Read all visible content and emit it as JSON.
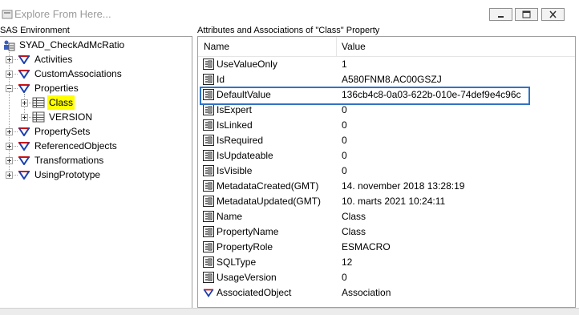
{
  "window": {
    "title": "Explore From Here...",
    "controls": [
      "minimize-icon",
      "maximize-icon",
      "close-icon"
    ]
  },
  "left_pane": {
    "header": "SAS Environment",
    "tree": [
      {
        "label": "SYAD_CheckAdMcRatio",
        "icon": "sas-object-icon",
        "expander": "none",
        "level": 0
      },
      {
        "label": "Activities",
        "icon": "association-icon",
        "expander": "plus",
        "level": 1
      },
      {
        "label": "CustomAssociations",
        "icon": "association-icon",
        "expander": "plus",
        "level": 1
      },
      {
        "label": "Properties",
        "icon": "association-icon",
        "expander": "minus",
        "level": 1
      },
      {
        "label": "Class",
        "icon": "table-icon",
        "expander": "plus",
        "level": 2,
        "highlighted": true
      },
      {
        "label": "VERSION",
        "icon": "table-icon",
        "expander": "plus",
        "level": 2
      },
      {
        "label": "PropertySets",
        "icon": "association-icon",
        "expander": "plus",
        "level": 1
      },
      {
        "label": "ReferencedObjects",
        "icon": "association-icon",
        "expander": "plus",
        "level": 1
      },
      {
        "label": "Transformations",
        "icon": "association-icon",
        "expander": "plus",
        "level": 1
      },
      {
        "label": "UsingPrototype",
        "icon": "association-icon",
        "expander": "plus",
        "level": 1
      }
    ]
  },
  "right_pane": {
    "header": "Attributes and Associations of \"Class\" Property",
    "columns": [
      "Name",
      "Value"
    ],
    "rows": [
      {
        "name": "UseValueOnly",
        "value": "1",
        "icon": "attribute-icon"
      },
      {
        "name": "Id",
        "value": "A580FNM8.AC00GSZJ",
        "icon": "attribute-icon"
      },
      {
        "name": "DefaultValue",
        "value": "136cb4c8-0a03-622b-010e-74def9e4c96c",
        "icon": "attribute-icon",
        "boxed": true
      },
      {
        "name": "IsExpert",
        "value": "0",
        "icon": "attribute-icon"
      },
      {
        "name": "IsLinked",
        "value": "0",
        "icon": "attribute-icon"
      },
      {
        "name": "IsRequired",
        "value": "0",
        "icon": "attribute-icon"
      },
      {
        "name": "IsUpdateable",
        "value": "0",
        "icon": "attribute-icon"
      },
      {
        "name": "IsVisible",
        "value": "0",
        "icon": "attribute-icon"
      },
      {
        "name": "MetadataCreated(GMT)",
        "value": "14. november 2018 13:28:19",
        "icon": "attribute-icon"
      },
      {
        "name": "MetadataUpdated(GMT)",
        "value": "10. marts 2021 10:24:11",
        "icon": "attribute-icon"
      },
      {
        "name": "Name",
        "value": "Class",
        "icon": "attribute-icon"
      },
      {
        "name": "PropertyName",
        "value": "Class",
        "icon": "attribute-icon"
      },
      {
        "name": "PropertyRole",
        "value": "ESMACRO",
        "icon": "attribute-icon"
      },
      {
        "name": "SQLType",
        "value": "12",
        "icon": "attribute-icon"
      },
      {
        "name": "UsageVersion",
        "value": "0",
        "icon": "attribute-icon"
      },
      {
        "name": "AssociatedObject",
        "value": "Association",
        "icon": "association-icon"
      }
    ]
  },
  "colors": {
    "highlight": "#ffff00",
    "selection_box": "#2f74c4",
    "association_red": "#cc1111",
    "association_blue": "#1a3fb0"
  }
}
